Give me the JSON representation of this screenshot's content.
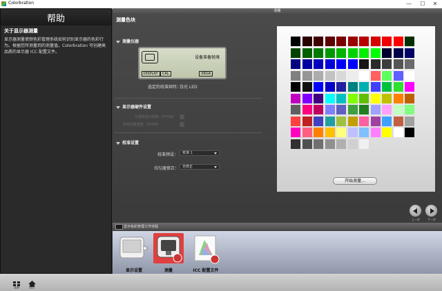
{
  "window": {
    "title": "Colorbration",
    "controls": [
      "—",
      "☐",
      "✕"
    ]
  },
  "help": {
    "title": "帮助",
    "subtitle": "关于显示器测量",
    "body": "显示器测量使颜色彩管理系统如何识别显示器的色彩行为。根据您所测量到的测量值，Colorbration 可创建高品质的显示器 ICC 配置文件。"
  },
  "header": {
    "title": "测量"
  },
  "main": {
    "title": "测量色块",
    "sections": {
      "instrument": "测量仪器",
      "hardware": "显示器硬件设置",
      "calibration": "校准设置"
    },
    "lcd": {
      "status": "设备准备就绪",
      "buttons": [
        "DISPLAY",
        "CAL",
        "XRGA"
      ]
    },
    "calibration_matrix": {
      "label": "选定的校准矩阵：",
      "value": "白光 LED"
    },
    "hardware_options": [
      "已修改显示控制（不可用）",
      "手动测量亮度（不可用）"
    ],
    "calib_preset": {
      "label": "校准预设：",
      "value": "校准 1"
    },
    "uniformity": {
      "label": "均匀度修正：",
      "value": "无修正"
    },
    "start_button": "开始测量..."
  },
  "nav": {
    "prev_label": "上一步",
    "next_label": "下一步"
  },
  "workflow": {
    "header": "显示色彩管理工作流程",
    "steps": [
      {
        "label": "显示设置",
        "active": false
      },
      {
        "label": "测量",
        "active": true
      },
      {
        "label": "ICC 配置文件",
        "active": false
      }
    ]
  },
  "footer": {
    "home_label": "全部",
    "page_label": "首页"
  },
  "patches": [
    [
      "#000000",
      "#2a0000",
      "#400000",
      "#5c0000",
      "#7a0000",
      "#9a0000",
      "#b80000",
      "#d80000",
      "#f00000",
      "#ff0000",
      "#003000"
    ],
    [
      "#004400",
      "#006000",
      "#007a00",
      "#009800",
      "#00b400",
      "#00d200",
      "#00f000",
      "#00ff00",
      "#000030",
      "#000048",
      "#000066"
    ],
    [
      "#000080",
      "#00009e",
      "#0000bc",
      "#0000da",
      "#0000f5",
      "#0000ff",
      "#161616",
      "#2a2a2a",
      "#3e3e3e",
      "#555555",
      "#6a6a6a"
    ],
    [
      "#808080",
      "#969696",
      "#acacac",
      "#c2c2c2",
      "#d8d8d8",
      "#ececec",
      "#ffffff",
      "#ff6060",
      "#60ff60",
      "#6060ff",
      "#ffffff"
    ],
    [
      "#000000",
      "#101010",
      "#0000ff",
      "#0000c8",
      "#2020a0",
      "#008080",
      "#00b0b0",
      "#4040ff",
      "#00c040",
      "#30e030",
      "#ff00ff"
    ],
    [
      "#c000c0",
      "#8000ff",
      "#400080",
      "#00ffff",
      "#00c0c0",
      "#80ff00",
      "#60c000",
      "#ffff00",
      "#c0c000",
      "#ff8000",
      "#c06000"
    ],
    [
      "#606060",
      "#ff0080",
      "#c00060",
      "#8080ff",
      "#6060c0",
      "#40a040",
      "#208020",
      "#a0a0ff",
      "#ffa0ff",
      "#c0ffc0",
      "#80ff80"
    ],
    [
      "#ff4040",
      "#c02020",
      "#4040c0",
      "#20a0a0",
      "#a0c040",
      "#c0a000",
      "#ff60a0",
      "#a040a0",
      "#40a0ff",
      "#c06040",
      "#a0a0a0"
    ],
    [
      "#ff00c0",
      "#ff6080",
      "#ff8000",
      "#ffc000",
      "#ffff80",
      "#c0c0ff",
      "#80c0ff",
      "#ff80ff",
      "#ffff00",
      "#ffffff",
      "#000000"
    ],
    [
      "#303030",
      "#505050",
      "#707070",
      "#909090",
      "#b0b0b0",
      "#d0d0d0",
      "#f0f0f0"
    ]
  ],
  "colors": {
    "active_step": "#e04040",
    "panel": "#3c3c3c",
    "board": "#ececec"
  }
}
